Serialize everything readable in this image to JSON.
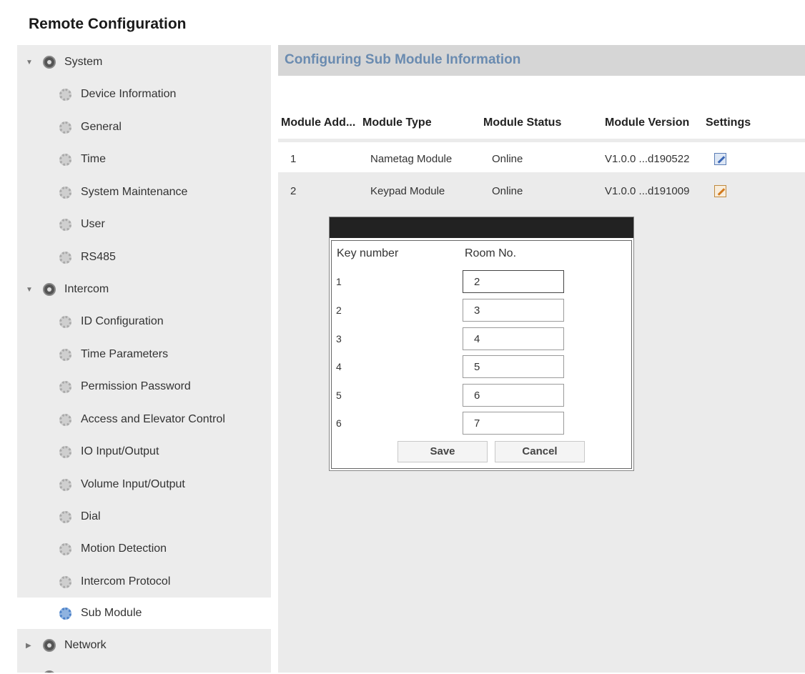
{
  "app": {
    "title": "Remote Configuration"
  },
  "sidebar": {
    "groups": [
      {
        "label": "System",
        "expanded": true,
        "icon": "gear-group-icon"
      },
      {
        "label": "Intercom",
        "expanded": true,
        "icon": "gear-group-icon"
      },
      {
        "label": "Network",
        "expanded": false,
        "icon": "gear-group-icon"
      }
    ],
    "system_items": [
      "Device Information",
      "General",
      "Time",
      "System Maintenance",
      "User",
      "RS485"
    ],
    "intercom_items": [
      "ID Configuration",
      "Time Parameters",
      "Permission Password",
      "Access and Elevator Control",
      "IO Input/Output",
      "Volume Input/Output",
      "Dial",
      "Motion Detection",
      "Intercom Protocol",
      "Sub Module"
    ],
    "selected": "Sub Module"
  },
  "main": {
    "title": "Configuring Sub Module Information",
    "columns": [
      "Module Add...",
      "Module Type",
      "Module Status",
      "Module Version",
      "Settings"
    ],
    "rows": [
      {
        "address": "1",
        "type": "Nametag Module",
        "status": "Online",
        "version": "V1.0.0 ...d190522",
        "settings_icon": "edit-icon"
      },
      {
        "address": "2",
        "type": "Keypad Module",
        "status": "Online",
        "version": "V1.0.0 ...d191009",
        "settings_icon": "edit-icon"
      }
    ]
  },
  "dialog": {
    "col_key": "Key number",
    "col_room": "Room No.",
    "rows": [
      {
        "key": "1",
        "room": "2"
      },
      {
        "key": "2",
        "room": "3"
      },
      {
        "key": "3",
        "room": "4"
      },
      {
        "key": "4",
        "room": "5"
      },
      {
        "key": "5",
        "room": "6"
      },
      {
        "key": "6",
        "room": "7"
      }
    ],
    "save_label": "Save",
    "cancel_label": "Cancel"
  },
  "colors": {
    "header_title": "#6a8bb0",
    "sidebar_bg": "#ececec",
    "dialog_titlebar": "#222222"
  }
}
